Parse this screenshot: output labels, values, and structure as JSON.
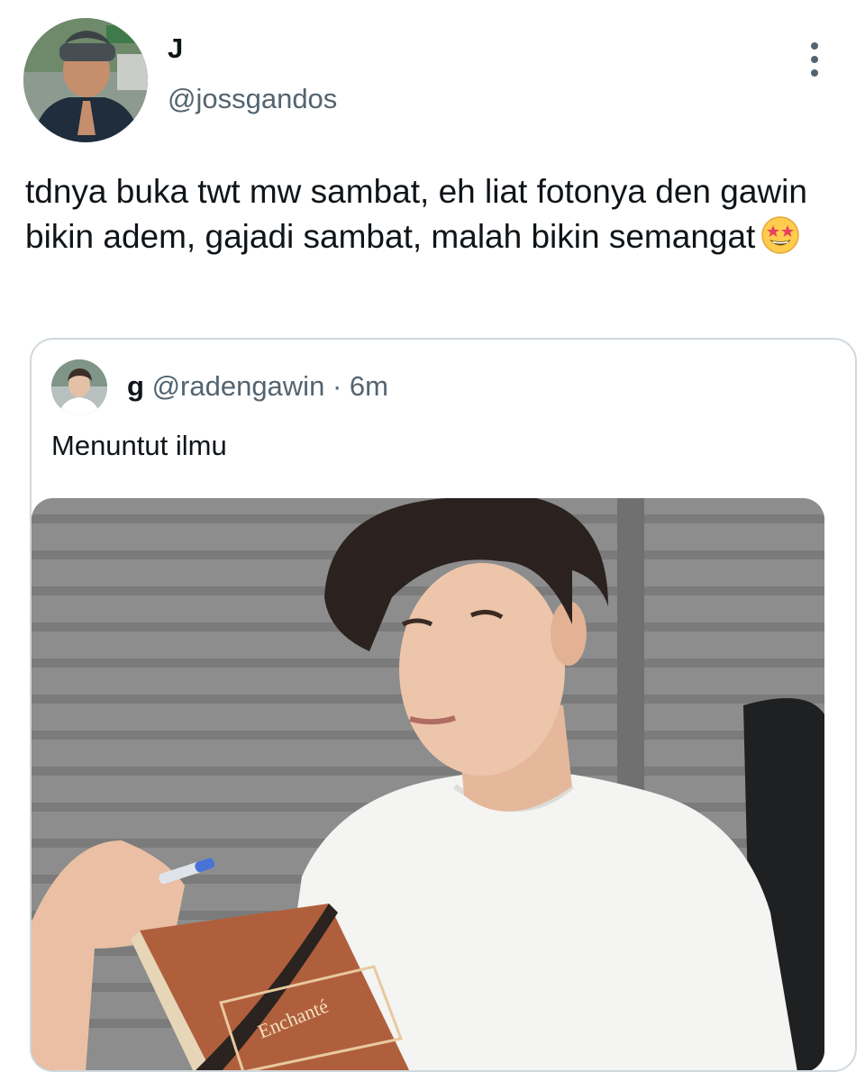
{
  "tweet": {
    "author": {
      "display_name": "J",
      "handle": "@jossgandos"
    },
    "text": "tdnya buka twt mw sambat, eh liat fotonya den gawin bikin adem, gajadi sambat, malah bikin semangat",
    "emoji": "star-struck-emoji",
    "more_icon": "more-vertical-icon"
  },
  "quoted_tweet": {
    "author": {
      "display_name": "g",
      "handle": "@radengawin"
    },
    "separator": "·",
    "time": "6m",
    "text": "Menuntut ilmu",
    "media": {
      "kind": "photo",
      "book_title": "Enchanté"
    }
  }
}
